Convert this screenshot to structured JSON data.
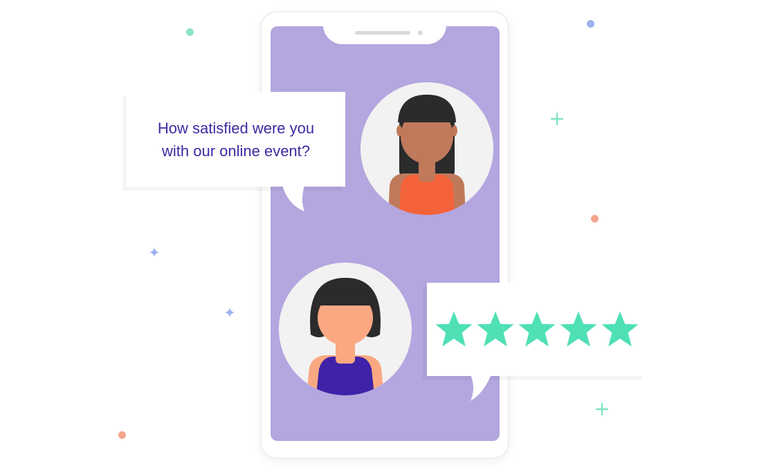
{
  "question": {
    "line1": "How satisfied were you",
    "line2": "with our online event?"
  },
  "rating": {
    "stars": 5,
    "max_stars": 5
  },
  "colors": {
    "screen": "#b4a6df",
    "question_text": "#3c2aa0",
    "star": "#4fe0b5",
    "avatar_bg": "#f2f2f2"
  }
}
